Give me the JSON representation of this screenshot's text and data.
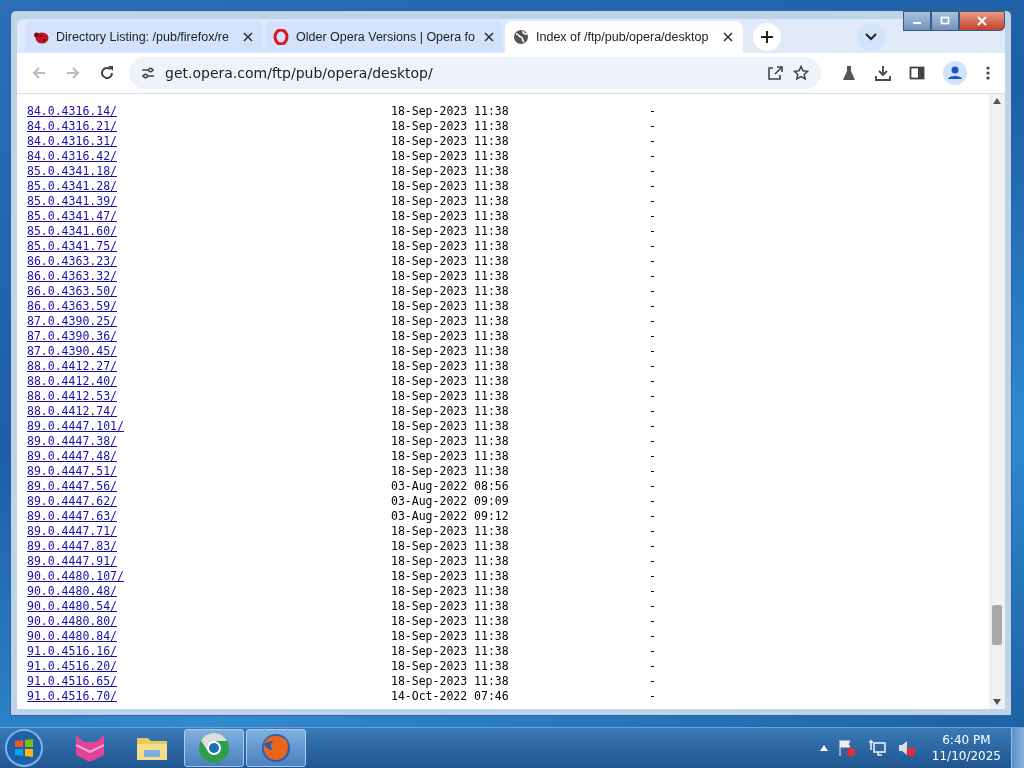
{
  "tabs": [
    {
      "title": "Directory Listing: /pub/firefox/re",
      "selected": false
    },
    {
      "title": "Older Opera Versions | Opera fo",
      "selected": false
    },
    {
      "title": "Index of /ftp/pub/opera/desktop",
      "selected": true
    }
  ],
  "address_bar": {
    "url": "get.opera.com/ftp/pub/opera/desktop/"
  },
  "listing": [
    {
      "name": "84.0.4316.14/",
      "date": "18-Sep-2023 11:38",
      "size": "-"
    },
    {
      "name": "84.0.4316.21/",
      "date": "18-Sep-2023 11:38",
      "size": "-"
    },
    {
      "name": "84.0.4316.31/",
      "date": "18-Sep-2023 11:38",
      "size": "-"
    },
    {
      "name": "84.0.4316.42/",
      "date": "18-Sep-2023 11:38",
      "size": "-"
    },
    {
      "name": "85.0.4341.18/",
      "date": "18-Sep-2023 11:38",
      "size": "-"
    },
    {
      "name": "85.0.4341.28/",
      "date": "18-Sep-2023 11:38",
      "size": "-"
    },
    {
      "name": "85.0.4341.39/",
      "date": "18-Sep-2023 11:38",
      "size": "-"
    },
    {
      "name": "85.0.4341.47/",
      "date": "18-Sep-2023 11:38",
      "size": "-"
    },
    {
      "name": "85.0.4341.60/",
      "date": "18-Sep-2023 11:38",
      "size": "-"
    },
    {
      "name": "85.0.4341.75/",
      "date": "18-Sep-2023 11:38",
      "size": "-"
    },
    {
      "name": "86.0.4363.23/",
      "date": "18-Sep-2023 11:38",
      "size": "-"
    },
    {
      "name": "86.0.4363.32/",
      "date": "18-Sep-2023 11:38",
      "size": "-"
    },
    {
      "name": "86.0.4363.50/",
      "date": "18-Sep-2023 11:38",
      "size": "-"
    },
    {
      "name": "86.0.4363.59/",
      "date": "18-Sep-2023 11:38",
      "size": "-"
    },
    {
      "name": "87.0.4390.25/",
      "date": "18-Sep-2023 11:38",
      "size": "-"
    },
    {
      "name": "87.0.4390.36/",
      "date": "18-Sep-2023 11:38",
      "size": "-"
    },
    {
      "name": "87.0.4390.45/",
      "date": "18-Sep-2023 11:38",
      "size": "-"
    },
    {
      "name": "88.0.4412.27/",
      "date": "18-Sep-2023 11:38",
      "size": "-"
    },
    {
      "name": "88.0.4412.40/",
      "date": "18-Sep-2023 11:38",
      "size": "-"
    },
    {
      "name": "88.0.4412.53/",
      "date": "18-Sep-2023 11:38",
      "size": "-"
    },
    {
      "name": "88.0.4412.74/",
      "date": "18-Sep-2023 11:38",
      "size": "-"
    },
    {
      "name": "89.0.4447.101/",
      "date": "18-Sep-2023 11:38",
      "size": "-"
    },
    {
      "name": "89.0.4447.38/",
      "date": "18-Sep-2023 11:38",
      "size": "-"
    },
    {
      "name": "89.0.4447.48/",
      "date": "18-Sep-2023 11:38",
      "size": "-"
    },
    {
      "name": "89.0.4447.51/",
      "date": "18-Sep-2023 11:38",
      "size": "-"
    },
    {
      "name": "89.0.4447.56/",
      "date": "03-Aug-2022 08:56",
      "size": "-"
    },
    {
      "name": "89.0.4447.62/",
      "date": "03-Aug-2022 09:09",
      "size": "-"
    },
    {
      "name": "89.0.4447.63/",
      "date": "03-Aug-2022 09:12",
      "size": "-"
    },
    {
      "name": "89.0.4447.71/",
      "date": "18-Sep-2023 11:38",
      "size": "-"
    },
    {
      "name": "89.0.4447.83/",
      "date": "18-Sep-2023 11:38",
      "size": "-"
    },
    {
      "name": "89.0.4447.91/",
      "date": "18-Sep-2023 11:38",
      "size": "-"
    },
    {
      "name": "90.0.4480.107/",
      "date": "18-Sep-2023 11:38",
      "size": "-"
    },
    {
      "name": "90.0.4480.48/",
      "date": "18-Sep-2023 11:38",
      "size": "-"
    },
    {
      "name": "90.0.4480.54/",
      "date": "18-Sep-2023 11:38",
      "size": "-"
    },
    {
      "name": "90.0.4480.80/",
      "date": "18-Sep-2023 11:38",
      "size": "-"
    },
    {
      "name": "90.0.4480.84/",
      "date": "18-Sep-2023 11:38",
      "size": "-"
    },
    {
      "name": "91.0.4516.16/",
      "date": "18-Sep-2023 11:38",
      "size": "-"
    },
    {
      "name": "91.0.4516.20/",
      "date": "18-Sep-2023 11:38",
      "size": "-"
    },
    {
      "name": "91.0.4516.65/",
      "date": "18-Sep-2023 11:38",
      "size": "-"
    },
    {
      "name": "91.0.4516.70/",
      "date": "14-Oct-2022 07:46",
      "size": "-"
    }
  ],
  "taskbar": {
    "apps": [
      {
        "selected": false
      },
      {
        "selected": false
      },
      {
        "selected": true
      },
      {
        "selected": true
      }
    ],
    "time": "6:40 PM",
    "date": "11/10/2025"
  }
}
